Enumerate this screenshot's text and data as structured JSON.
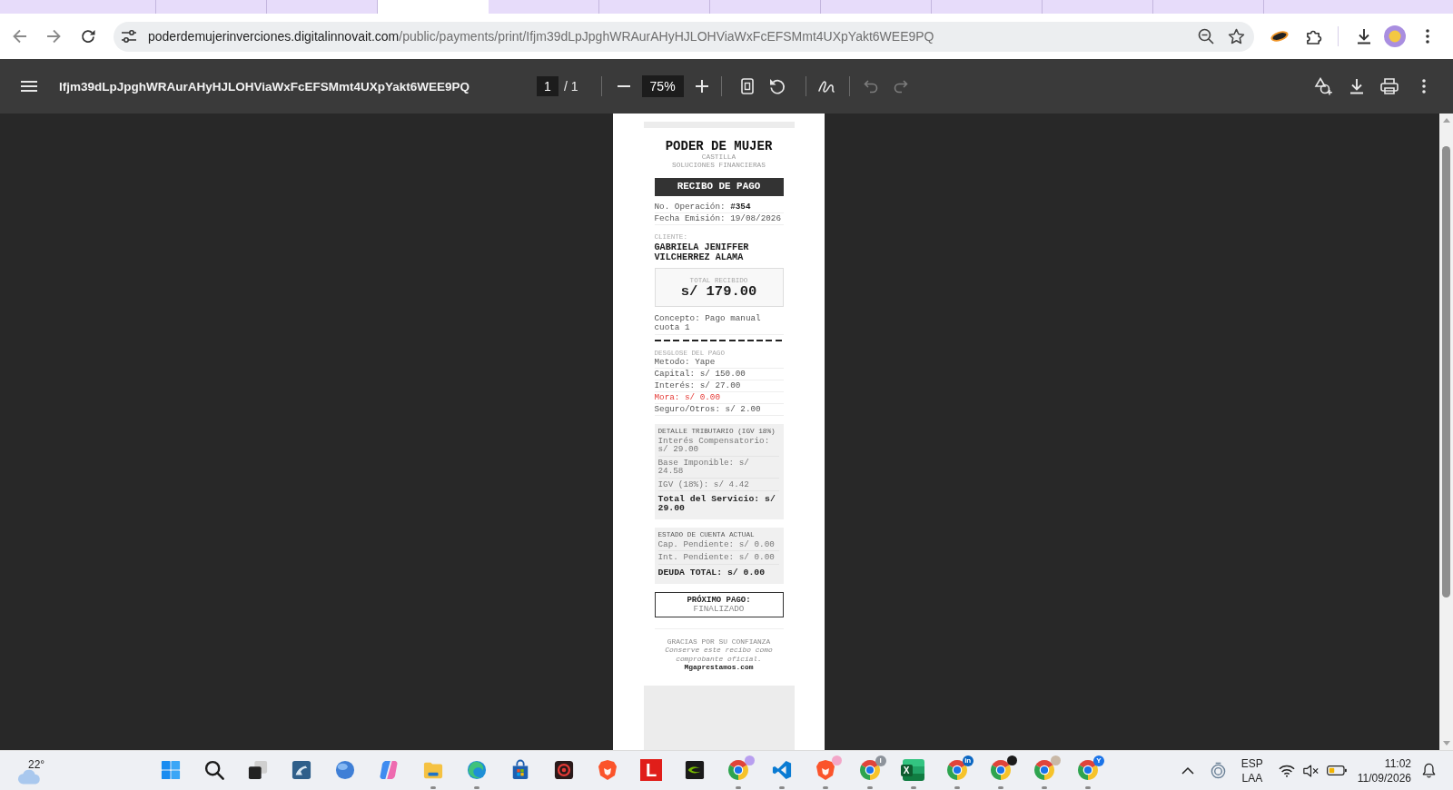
{
  "browser": {
    "tabs": [
      {
        "selected": false
      },
      {
        "selected": false
      },
      {
        "selected": false
      },
      {
        "selected": true
      },
      {
        "selected": false
      },
      {
        "selected": false
      },
      {
        "selected": false
      },
      {
        "selected": false
      },
      {
        "selected": false
      },
      {
        "selected": false
      },
      {
        "selected": false
      }
    ],
    "url": {
      "host": "poderdemujerinverciones.digitalinnovait.com",
      "path": "/public/payments/print/Ifjm39dLpJpghWRAurAHyHJLOHViaWxFcEFSMmt4UXpYakt6WEE9PQ"
    }
  },
  "pdf_toolbar": {
    "title": "Ifjm39dLpJpghWRAurAHyHJLOHViaWxFcEFSMmt4UXpYakt6WEE9PQ",
    "page": "1",
    "page_count": "/ 1",
    "zoom": "75%",
    "undo_disabled": true,
    "redo_disabled": true
  },
  "receipt": {
    "company": "PODER DE MUJER",
    "branch": "CASTILLA",
    "tagline": "SOLUCIONES FINANCIERAS",
    "title": "RECIBO DE PAGO",
    "fields": [
      "No. Operación: **#354**",
      "Fecha Emisión: 19/08/2026"
    ],
    "client_label": "CLIENTE:",
    "client_name": "GABRIELA JENIFFER VILCHERREZ ALAMA",
    "total_label": "TOTAL RECIBIDO",
    "total": "s/ 179.00",
    "concept": "Concepto: Pago manual cuota 1",
    "breakdown_title": "DESGLOSE DEL PAGO",
    "breakdown": [
      {
        "text": "Metodo: Yape",
        "kind": "plain"
      },
      {
        "text": "Capital: s/ 150.00",
        "kind": "plain"
      },
      {
        "text": "Interés: s/ 27.00",
        "kind": "plain"
      },
      {
        "text": "Mora: s/ 0.00",
        "kind": "alert"
      },
      {
        "text": "Seguro/Otros: s/ 2.00",
        "kind": "plain"
      }
    ],
    "panels": [
      {
        "title": "DETALLE TRIBUTARIO (IGV 18%)",
        "lines": [
          {
            "text": "Interés Compensatorio: s/ 29.00",
            "kind": "line"
          },
          {
            "text": "Base Imponible: s/ 24.58",
            "kind": "line"
          },
          {
            "text": "IGV (18%): s/ 4.42",
            "kind": "line"
          },
          {
            "text": "Total del Servicio: s/ 29.00",
            "kind": "total"
          }
        ]
      },
      {
        "title": "ESTADO DE CUENTA ACTUAL",
        "lines": [
          {
            "text": "Cap. Pendiente: s/ 0.00",
            "kind": "line"
          },
          {
            "text": "Int. Pendiente: s/ 0.00",
            "kind": "line"
          },
          {
            "text": "DEUDA TOTAL: s/ 0.00",
            "kind": "total"
          }
        ]
      }
    ],
    "next_payment": {
      "label": "PRÓXIMO PAGO:",
      "value": "FINALIZADO"
    },
    "footer": {
      "thanks": "GRACIAS POR SU CONFIANZA",
      "note": "Conserve este recibo como comprobante oficial.",
      "site": "Mgaprestamos.com"
    }
  },
  "taskbar": {
    "weather": "22°",
    "apps": [
      {
        "kind": "start",
        "running": false
      },
      {
        "kind": "search",
        "running": false
      },
      {
        "kind": "taskview",
        "running": false
      },
      {
        "kind": "tile",
        "running": false
      },
      {
        "kind": "sphere",
        "running": false
      },
      {
        "kind": "ribbon",
        "running": false
      },
      {
        "kind": "folder",
        "running": true
      },
      {
        "kind": "wave",
        "running": true
      },
      {
        "kind": "store",
        "running": false
      },
      {
        "kind": "recorder",
        "running": false
      },
      {
        "kind": "shield",
        "running": false
      },
      {
        "kind": "letter",
        "letter": "L",
        "running": false
      },
      {
        "kind": "eye",
        "running": false
      },
      {
        "kind": "browser",
        "color": "#b89ff0",
        "running": true
      },
      {
        "kind": "editor",
        "running": true
      },
      {
        "kind": "shield",
        "color": "#f3a6c8",
        "running": true
      },
      {
        "kind": "browser",
        "badge_text": "I",
        "color": "#8d939b",
        "running": true
      },
      {
        "kind": "sheet",
        "letter": "X",
        "running": true
      },
      {
        "kind": "browser",
        "badge_text": "in",
        "color": "#0a66c2",
        "running": true
      },
      {
        "kind": "browser",
        "color": "#1b1b1b",
        "running": true
      },
      {
        "kind": "browser",
        "color": "#c9b8a6",
        "running": true
      },
      {
        "kind": "browser",
        "badge_text": "Y",
        "color": "#1a73e8",
        "running": true
      }
    ],
    "tray": {
      "language": "ESP",
      "layout": "LAA",
      "time": "11:02",
      "date": "11/09/2026"
    }
  }
}
